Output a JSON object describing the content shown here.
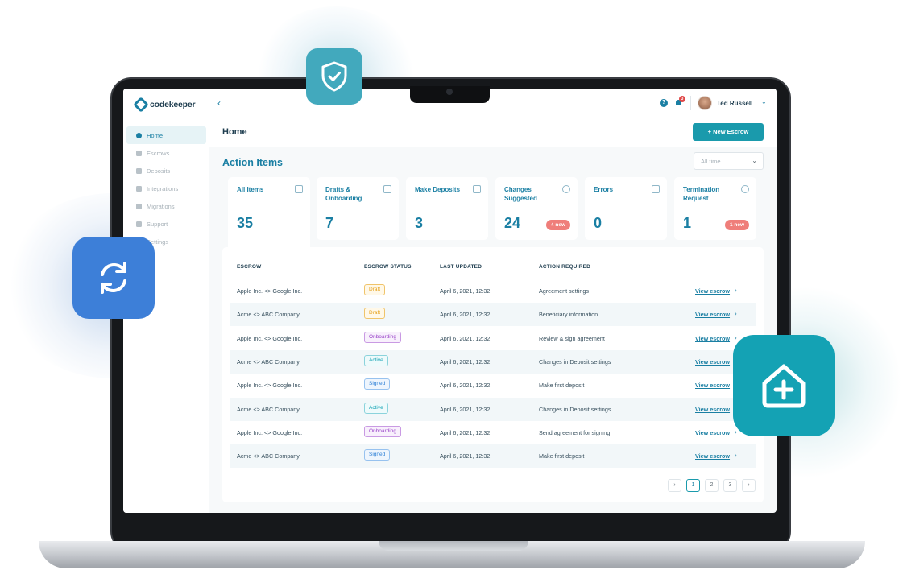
{
  "colors": {
    "brand": "#1a7fa3",
    "primary_button": "#1a9aac",
    "badge_red": "#ef7e7a",
    "sync_tile": "#3d7fd8",
    "home_tile": "#14a2b4",
    "shield_tile": "#42a9bd"
  },
  "floating_icons": [
    "shield-check-icon",
    "sync-icon",
    "house-plus-icon"
  ],
  "app": {
    "logo_text": "codekeeper"
  },
  "sidebar": {
    "items": [
      {
        "label": "Home",
        "icon": "home-icon",
        "active": true
      },
      {
        "label": "Escrows",
        "icon": "document-icon"
      },
      {
        "label": "Deposits",
        "icon": "document-icon"
      },
      {
        "label": "Integrations",
        "icon": "grid-icon"
      },
      {
        "label": "Migrations",
        "icon": "grid-icon"
      },
      {
        "label": "Support",
        "icon": "chat-icon"
      },
      {
        "label": "Settings",
        "icon": "gear-icon"
      }
    ]
  },
  "topbar": {
    "notification_count": "3",
    "user_name": "Ted Russell",
    "help_label": "?"
  },
  "header": {
    "title": "Home",
    "new_button": "+ New Escrow"
  },
  "action_items": {
    "title": "Action Items",
    "filter": "All time",
    "cards": [
      {
        "label": "All Items",
        "value": "35",
        "icon": "list-icon"
      },
      {
        "label": "Drafts & Onboarding",
        "value": "7",
        "icon": "edit-icon"
      },
      {
        "label": "Make Deposits",
        "value": "3",
        "icon": "folder-icon"
      },
      {
        "label": "Changes Suggested",
        "value": "24",
        "icon": "gear-icon",
        "badge": "4 new"
      },
      {
        "label": "Errors",
        "value": "0",
        "icon": "warning-icon"
      },
      {
        "label": "Termination Request",
        "value": "1",
        "icon": "close-circle-icon",
        "badge": "1 new"
      }
    ]
  },
  "table": {
    "headers": [
      "ESCROW",
      "ESCROW STATUS",
      "LAST UPDATED",
      "ACTION REQUIRED"
    ],
    "link_label": "View escrow",
    "rows": [
      {
        "escrow": "Apple Inc. <> Google Inc.",
        "status": "Draft",
        "updated": "April 6, 2021, 12:32",
        "action": "Agreement settings"
      },
      {
        "escrow": "Acme <> ABC Company",
        "status": "Draft",
        "updated": "April 6, 2021, 12:32",
        "action": "Beneficiary information"
      },
      {
        "escrow": "Apple Inc. <> Google Inc.",
        "status": "Onboarding",
        "updated": "April 6, 2021, 12:32",
        "action": "Review & sign agreement"
      },
      {
        "escrow": "Acme <> ABC Company",
        "status": "Active",
        "updated": "April 6, 2021, 12:32",
        "action": "Changes in Deposit settings"
      },
      {
        "escrow": "Apple Inc. <> Google Inc.",
        "status": "Signed",
        "updated": "April 6, 2021, 12:32",
        "action": "Make first deposit"
      },
      {
        "escrow": "Acme <> ABC Company",
        "status": "Active",
        "updated": "April 6, 2021, 12:32",
        "action": "Changes in Deposit settings"
      },
      {
        "escrow": "Apple Inc. <> Google Inc.",
        "status": "Onboarding",
        "updated": "April 6, 2021, 12:32",
        "action": "Send agreement for signing"
      },
      {
        "escrow": "Acme <> ABC Company",
        "status": "Signed",
        "updated": "April 6, 2021, 12:32",
        "action": "Make first deposit"
      }
    ]
  },
  "pagination": {
    "pages": [
      "1",
      "2",
      "3"
    ],
    "current": "1"
  }
}
